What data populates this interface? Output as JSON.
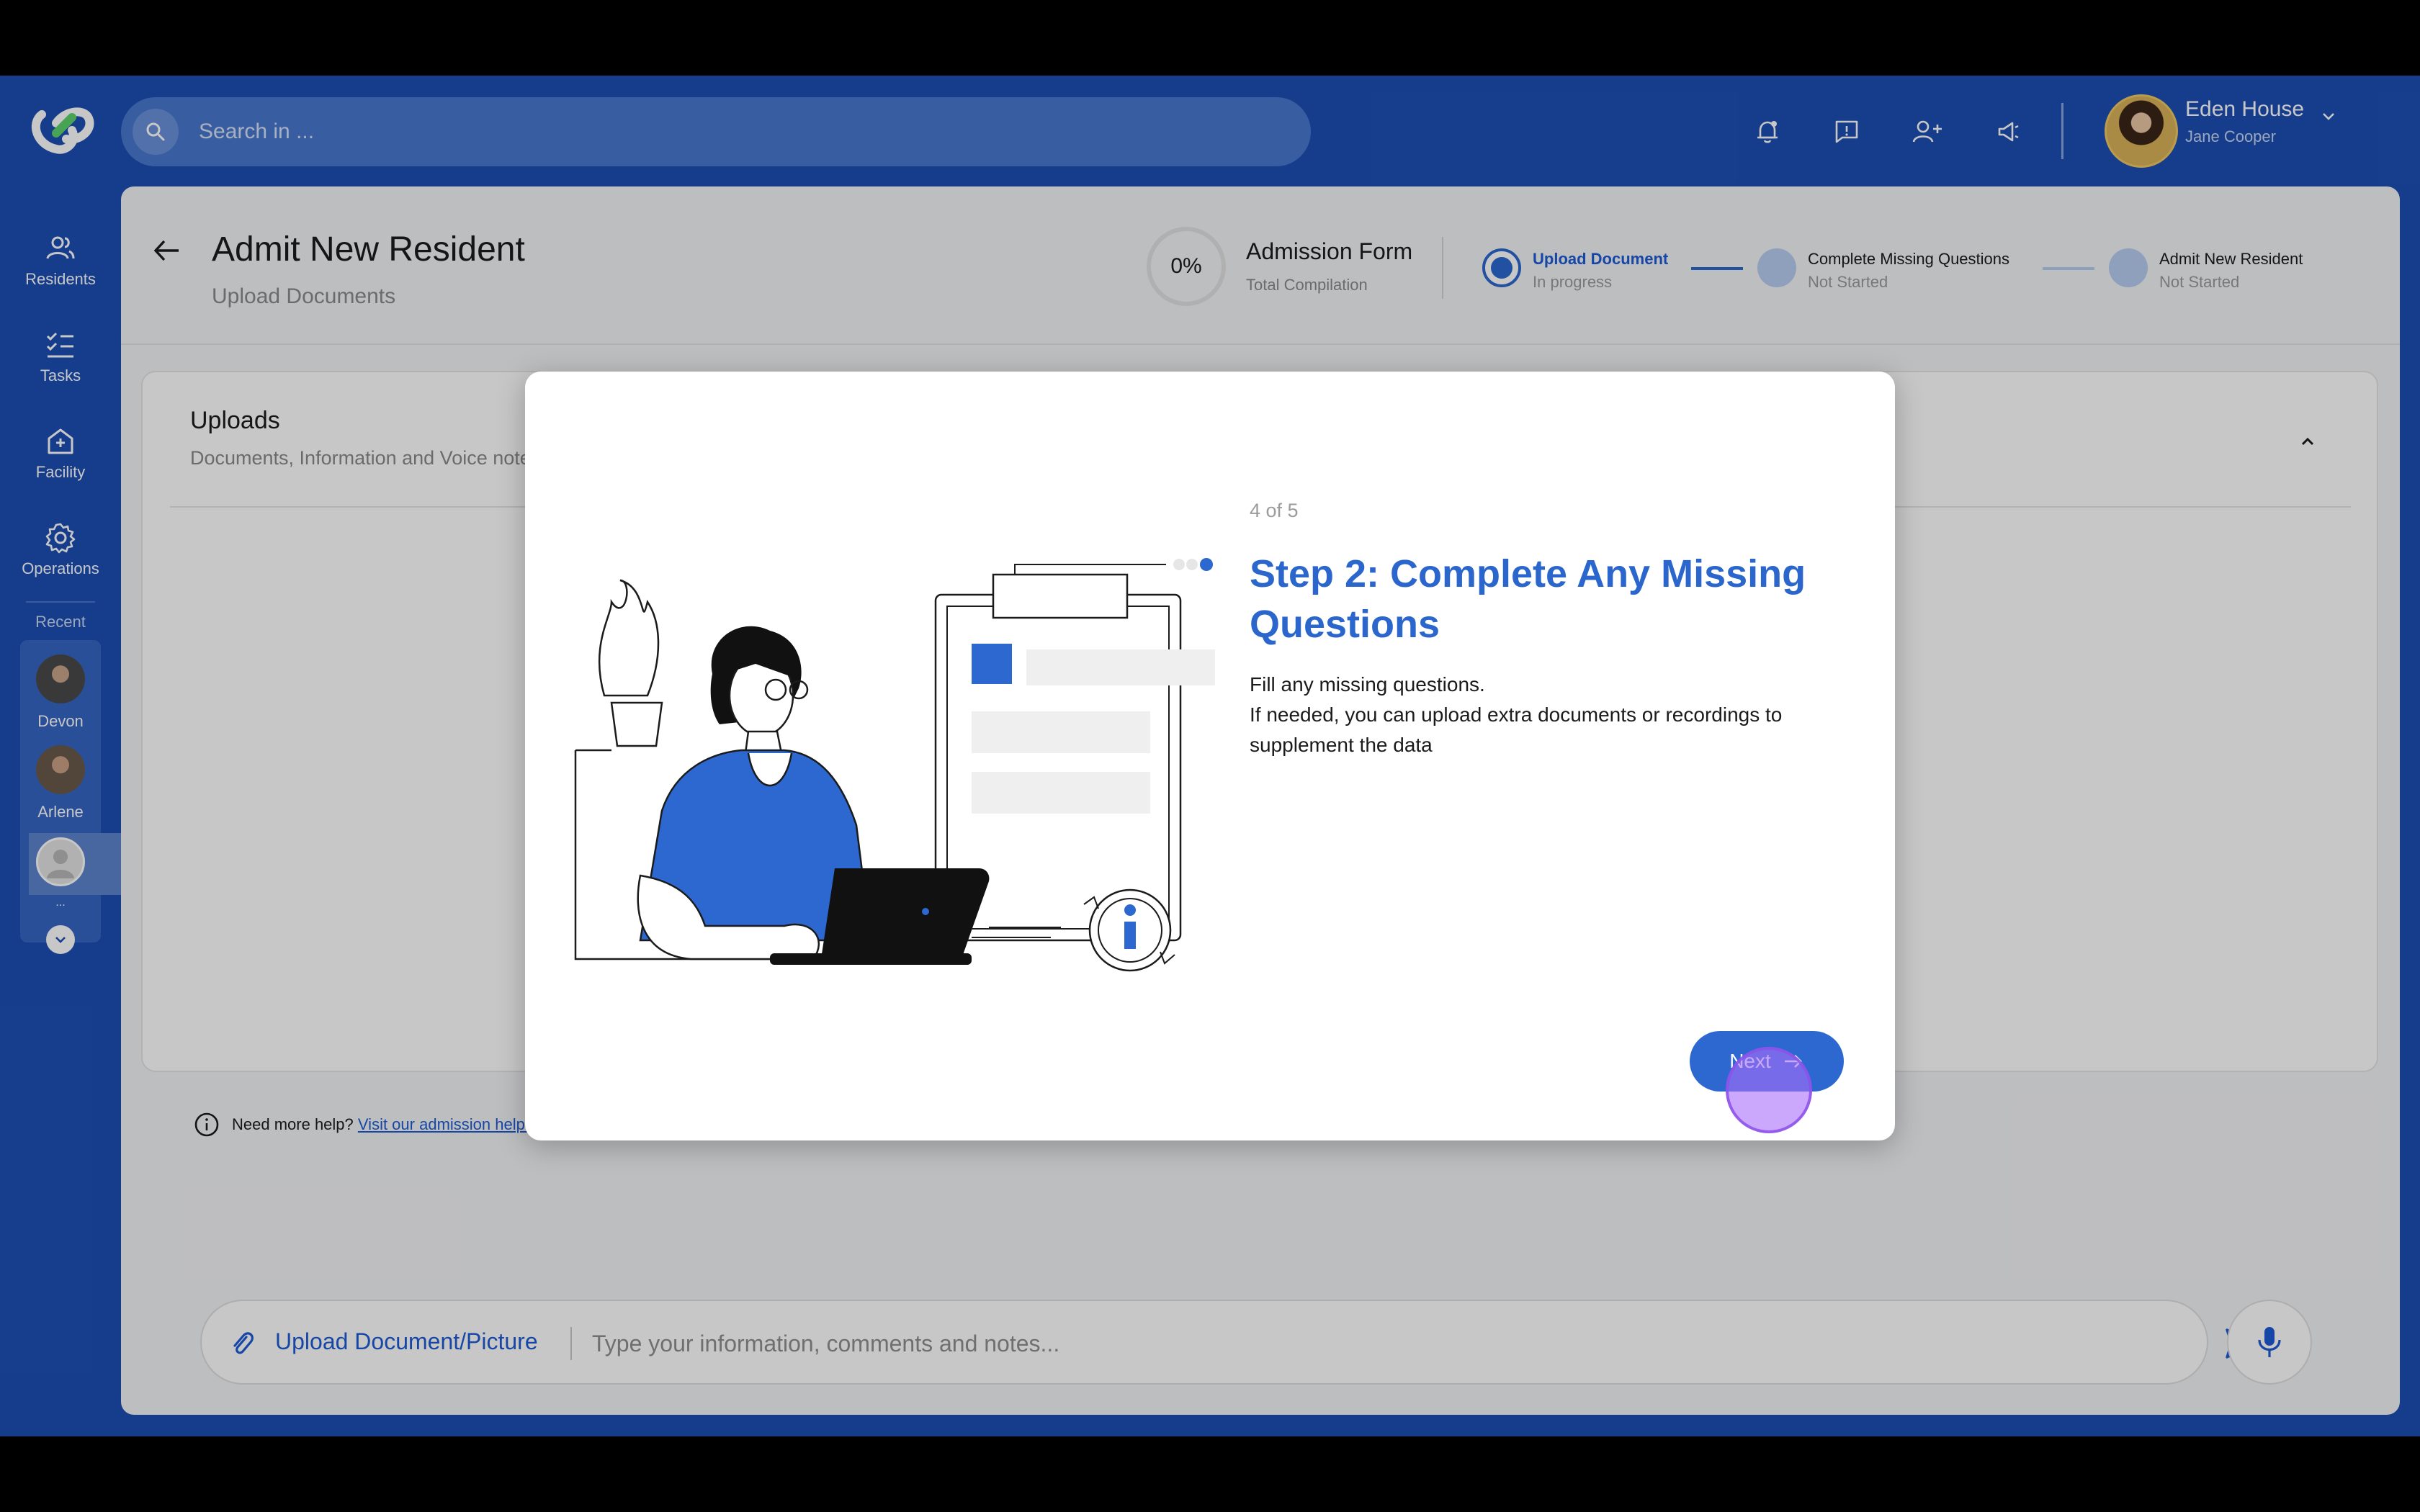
{
  "search": {
    "placeholder": "Search in ..."
  },
  "user": {
    "name": "Eden House",
    "subtitle": "Jane Cooper"
  },
  "sidebar": {
    "items": [
      {
        "label": "Residents",
        "icon": "residents-icon"
      },
      {
        "label": "Tasks",
        "icon": "tasks-icon"
      },
      {
        "label": "Facility",
        "icon": "facility-icon"
      },
      {
        "label": "Operations",
        "icon": "gear-icon"
      }
    ],
    "recent_label": "Recent",
    "recent": [
      {
        "name": "Devon"
      },
      {
        "name": "Arlene"
      },
      {
        "name": "..."
      }
    ]
  },
  "page": {
    "title": "Admit New Resident",
    "subtitle": "Upload Documents"
  },
  "progress": {
    "percent": "0%",
    "title": "Admission Form",
    "subtitle": "Total Compilation"
  },
  "steps": [
    {
      "label": "Upload Document",
      "status": "In progress"
    },
    {
      "label": "Complete Missing Questions",
      "status": "Not Started"
    },
    {
      "label": "Admit New Resident",
      "status": "Not Started"
    }
  ],
  "uploads": {
    "title": "Uploads",
    "subtitle": "Documents, Information and Voice notes"
  },
  "help": {
    "text": "Need more help?",
    "link": "Visit our admission help page"
  },
  "composer": {
    "upload_label": "Upload Document/Picture",
    "placeholder": "Type your information, comments and notes..."
  },
  "modal": {
    "step_count": "4 of 5",
    "title": "Step 2: Complete Any Missing Questions",
    "body_line1": "Fill any missing questions.",
    "body_line2": "If needed, you can upload extra documents or recordings to supplement the data",
    "next_label": "Next"
  },
  "colors": {
    "brand": "#1d4fb4",
    "accent": "#2c68cf",
    "panel": "#f3f4f6"
  }
}
